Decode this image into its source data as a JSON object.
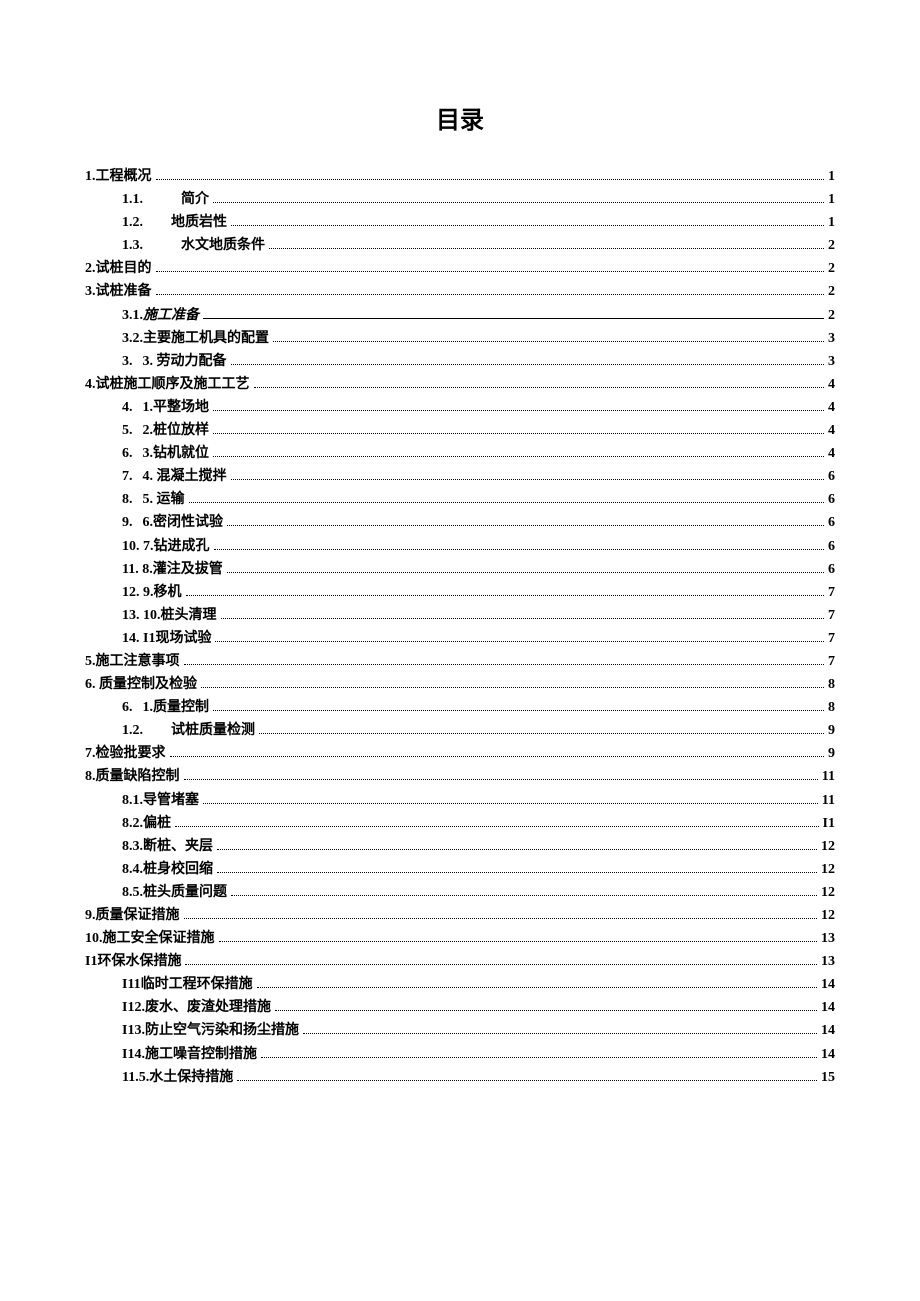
{
  "title": "目录",
  "entries": [
    {
      "level": 0,
      "num": "1",
      "label": " .工程概况",
      "page": "1",
      "bold": true
    },
    {
      "level": 1,
      "num": "1.1.",
      "label": "简介",
      "page": "1",
      "bold": true,
      "gap": "md"
    },
    {
      "level": 1,
      "num": "1.2.",
      "label": "地质岩性",
      "page": "1",
      "bold": true,
      "gap": "sm"
    },
    {
      "level": 1,
      "num": "1.3.",
      "label": "水文地质条件",
      "page": "2",
      "bold": true,
      "gap": "md"
    },
    {
      "level": 0,
      "num": "2",
      "label": " .试桩目的",
      "page": "2",
      "bold": true
    },
    {
      "level": 0,
      "num": "3",
      "label": " .试桩准备",
      "page": "2",
      "bold": true
    },
    {
      "level": 1,
      "num": "3.1.",
      "label": "施工准备",
      "page": "2",
      "bold": true,
      "italic": true,
      "heavy": true
    },
    {
      "level": 1,
      "num": "3.2.",
      "label": "主要施工机具的配置",
      "page": "3",
      "bold": true
    },
    {
      "level": 1,
      "num": "3.",
      "label": "3. 劳动力配备",
      "page": "3",
      "bold": true,
      "gap": "xs"
    },
    {
      "level": 0,
      "num": "4",
      "label": " .试桩施工顺序及施工工艺",
      "page": "4",
      "bold": true
    },
    {
      "level": 1,
      "num": "4.",
      "label": "1.平整场地",
      "page": "4",
      "bold": true,
      "gap": "xs"
    },
    {
      "level": 1,
      "num": "5.",
      "label": "2.桩位放样",
      "page": "4",
      "bold": true,
      "gap": "xs"
    },
    {
      "level": 1,
      "num": "6.",
      "label": "3.钻机就位",
      "page": "4",
      "bold": true,
      "gap": "xs"
    },
    {
      "level": 1,
      "num": "7.",
      "label": "4. 混凝土搅拌",
      "page": "6",
      "bold": true,
      "gap": "xs"
    },
    {
      "level": 1,
      "num": "8.",
      "label": "5. 运输",
      "page": "6",
      "bold": true,
      "gap": "xs"
    },
    {
      "level": 1,
      "num": "9.",
      "label": "6.密闭性试验",
      "page": "6",
      "bold": true,
      "gap": "xs"
    },
    {
      "level": 1,
      "num": "10. 7.",
      "label": "钻进成孔",
      "page": "6",
      "bold": true
    },
    {
      "level": 1,
      "num": "11. 8.",
      "label": "灌注及拔管",
      "page": "6",
      "bold": true
    },
    {
      "level": 1,
      "num": "12. 9.",
      "label": "移机",
      "page": "7",
      "bold": true
    },
    {
      "level": 1,
      "num": "13. 10.",
      "label": "桩头清理",
      "page": "7",
      "bold": true
    },
    {
      "level": 1,
      "num": "14. I1",
      "label": "现场试验",
      "page": "7",
      "bold": true
    },
    {
      "level": 0,
      "num": "5",
      "label": " .施工注意事项",
      "page": "7",
      "bold": true
    },
    {
      "level": 0,
      "num": "6",
      "label": " . 质量控制及检验",
      "page": "8",
      "bold": true
    },
    {
      "level": 1,
      "num": "6.",
      "label": "1.质量控制",
      "page": "8",
      "bold": true,
      "gap": "xs"
    },
    {
      "level": 1,
      "num": "1.2.",
      "label": "试桩质量检测",
      "page": "9",
      "bold": true,
      "gap": "sm"
    },
    {
      "level": 0,
      "num": "7",
      "label": " .检验批要求",
      "page": "9",
      "bold": true
    },
    {
      "level": 0,
      "num": "8",
      "label": " .质量缺陷控制",
      "page": "11",
      "bold": true
    },
    {
      "level": 1,
      "num": "8.1.",
      "label": "导管堵塞",
      "page": "11",
      "bold": true
    },
    {
      "level": 1,
      "num": "8.2.",
      "label": " 偏桩",
      "page": "I1",
      "bold": true
    },
    {
      "level": 1,
      "num": "8.3.",
      "label": "断桩、夹层",
      "page": "12",
      "bold": true
    },
    {
      "level": 1,
      "num": "8.4.",
      "label": " 桩身校回缩",
      "page": "12",
      "bold": true
    },
    {
      "level": 1,
      "num": "8.5.",
      "label": "桩头质量问题",
      "page": "12",
      "bold": true
    },
    {
      "level": 0,
      "num": "9.",
      "label": "质量保证措施",
      "page": "12",
      "bold": true
    },
    {
      "level": 0,
      "num": "10.",
      "label": "施工安全保证措施",
      "page": "13",
      "bold": true
    },
    {
      "level": 0,
      "num": "I1",
      "label": "环保水保措施",
      "page": "13",
      "bold": true
    },
    {
      "level": 1,
      "num": "I11",
      "label": "临时工程环保措施",
      "page": "14",
      "bold": true
    },
    {
      "level": 1,
      "num": "I12.",
      "label": "废水、废渣处理措施",
      "page": "14",
      "bold": true
    },
    {
      "level": 1,
      "num": "I13.",
      "label": "防止空气污染和扬尘措施",
      "page": "14",
      "bold": true
    },
    {
      "level": 1,
      "num": "I14.",
      "label": "施工噪音控制措施",
      "page": "14",
      "bold": true
    },
    {
      "level": 1,
      "num": "11.5.",
      "label": "水土保持措施",
      "page": "15",
      "bold": true
    }
  ]
}
